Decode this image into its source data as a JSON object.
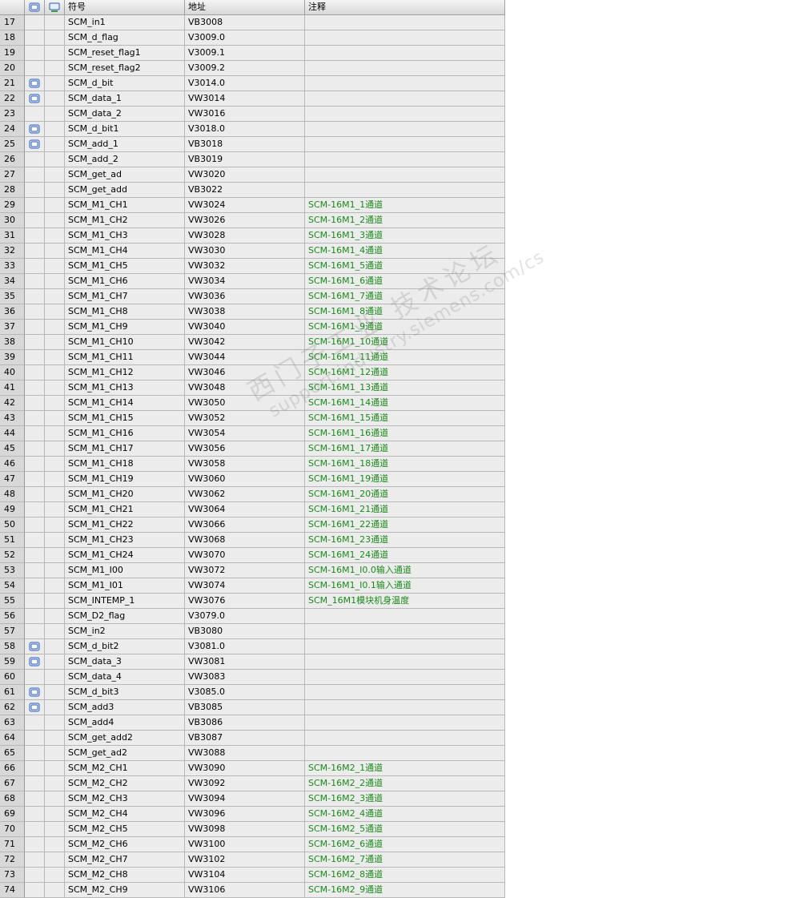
{
  "header": {
    "col_symbol": "符号",
    "col_address": "地址",
    "col_comment": "注释",
    "icon1": "symbol-overlap-icon",
    "icon2": "symbol-unused-icon"
  },
  "colors": {
    "comment_text": "#1a8a1a",
    "row_bg": "#ececec",
    "number_bg": "#d8d8d8"
  },
  "rows": [
    {
      "num": "17",
      "icon": false,
      "symbol": "SCM_in1",
      "address": "VB3008",
      "comment": ""
    },
    {
      "num": "18",
      "icon": false,
      "symbol": "SCM_d_flag",
      "address": "V3009.0",
      "comment": ""
    },
    {
      "num": "19",
      "icon": false,
      "symbol": "SCM_reset_flag1",
      "address": "V3009.1",
      "comment": ""
    },
    {
      "num": "20",
      "icon": false,
      "symbol": "SCM_reset_flag2",
      "address": "V3009.2",
      "comment": ""
    },
    {
      "num": "21",
      "icon": true,
      "symbol": "SCM_d_bit",
      "address": "V3014.0",
      "comment": ""
    },
    {
      "num": "22",
      "icon": true,
      "symbol": "SCM_data_1",
      "address": "VW3014",
      "comment": ""
    },
    {
      "num": "23",
      "icon": false,
      "symbol": "SCM_data_2",
      "address": "VW3016",
      "comment": ""
    },
    {
      "num": "24",
      "icon": true,
      "symbol": "SCM_d_bit1",
      "address": "V3018.0",
      "comment": ""
    },
    {
      "num": "25",
      "icon": true,
      "symbol": "SCM_add_1",
      "address": "VB3018",
      "comment": ""
    },
    {
      "num": "26",
      "icon": false,
      "symbol": "SCM_add_2",
      "address": "VB3019",
      "comment": ""
    },
    {
      "num": "27",
      "icon": false,
      "symbol": "SCM_get_ad",
      "address": "VW3020",
      "comment": ""
    },
    {
      "num": "28",
      "icon": false,
      "symbol": "SCM_get_add",
      "address": "VB3022",
      "comment": ""
    },
    {
      "num": "29",
      "icon": false,
      "symbol": "SCM_M1_CH1",
      "address": "VW3024",
      "comment": "SCM-16M1_1通道"
    },
    {
      "num": "30",
      "icon": false,
      "symbol": "SCM_M1_CH2",
      "address": "VW3026",
      "comment": "SCM-16M1_2通道"
    },
    {
      "num": "31",
      "icon": false,
      "symbol": "SCM_M1_CH3",
      "address": "VW3028",
      "comment": "SCM-16M1_3通道"
    },
    {
      "num": "32",
      "icon": false,
      "symbol": "SCM_M1_CH4",
      "address": "VW3030",
      "comment": "SCM-16M1_4通道"
    },
    {
      "num": "33",
      "icon": false,
      "symbol": "SCM_M1_CH5",
      "address": "VW3032",
      "comment": "SCM-16M1_5通道"
    },
    {
      "num": "34",
      "icon": false,
      "symbol": "SCM_M1_CH6",
      "address": "VW3034",
      "comment": "SCM-16M1_6通道"
    },
    {
      "num": "35",
      "icon": false,
      "symbol": "SCM_M1_CH7",
      "address": "VW3036",
      "comment": "SCM-16M1_7通道"
    },
    {
      "num": "36",
      "icon": false,
      "symbol": "SCM_M1_CH8",
      "address": "VW3038",
      "comment": "SCM-16M1_8通道"
    },
    {
      "num": "37",
      "icon": false,
      "symbol": "SCM_M1_CH9",
      "address": "VW3040",
      "comment": "SCM-16M1_9通道"
    },
    {
      "num": "38",
      "icon": false,
      "symbol": "SCM_M1_CH10",
      "address": "VW3042",
      "comment": "SCM-16M1_10通道"
    },
    {
      "num": "39",
      "icon": false,
      "symbol": "SCM_M1_CH11",
      "address": "VW3044",
      "comment": "SCM-16M1_11通道"
    },
    {
      "num": "40",
      "icon": false,
      "symbol": "SCM_M1_CH12",
      "address": "VW3046",
      "comment": "SCM-16M1_12通道"
    },
    {
      "num": "41",
      "icon": false,
      "symbol": "SCM_M1_CH13",
      "address": "VW3048",
      "comment": "SCM-16M1_13通道"
    },
    {
      "num": "42",
      "icon": false,
      "symbol": "SCM_M1_CH14",
      "address": "VW3050",
      "comment": "SCM-16M1_14通道"
    },
    {
      "num": "43",
      "icon": false,
      "symbol": "SCM_M1_CH15",
      "address": "VW3052",
      "comment": "SCM-16M1_15通道"
    },
    {
      "num": "44",
      "icon": false,
      "symbol": "SCM_M1_CH16",
      "address": "VW3054",
      "comment": "SCM-16M1_16通道"
    },
    {
      "num": "45",
      "icon": false,
      "symbol": "SCM_M1_CH17",
      "address": "VW3056",
      "comment": "SCM-16M1_17通道"
    },
    {
      "num": "46",
      "icon": false,
      "symbol": "SCM_M1_CH18",
      "address": "VW3058",
      "comment": "SCM-16M1_18通道"
    },
    {
      "num": "47",
      "icon": false,
      "symbol": "SCM_M1_CH19",
      "address": "VW3060",
      "comment": "SCM-16M1_19通道"
    },
    {
      "num": "48",
      "icon": false,
      "symbol": "SCM_M1_CH20",
      "address": "VW3062",
      "comment": "SCM-16M1_20通道"
    },
    {
      "num": "49",
      "icon": false,
      "symbol": "SCM_M1_CH21",
      "address": "VW3064",
      "comment": "SCM-16M1_21通道"
    },
    {
      "num": "50",
      "icon": false,
      "symbol": "SCM_M1_CH22",
      "address": "VW3066",
      "comment": "SCM-16M1_22通道"
    },
    {
      "num": "51",
      "icon": false,
      "symbol": "SCM_M1_CH23",
      "address": "VW3068",
      "comment": "SCM-16M1_23通道"
    },
    {
      "num": "52",
      "icon": false,
      "symbol": "SCM_M1_CH24",
      "address": "VW3070",
      "comment": "SCM-16M1_24通道"
    },
    {
      "num": "53",
      "icon": false,
      "symbol": "SCM_M1_I00",
      "address": "VW3072",
      "comment": "SCM-16M1_I0.0输入通道"
    },
    {
      "num": "54",
      "icon": false,
      "symbol": "SCM_M1_I01",
      "address": "VW3074",
      "comment": "SCM-16M1_I0.1输入通道"
    },
    {
      "num": "55",
      "icon": false,
      "symbol": "SCM_INTEMP_1",
      "address": "VW3076",
      "comment": "SCM_16M1模块机身温度"
    },
    {
      "num": "56",
      "icon": false,
      "symbol": "SCM_D2_flag",
      "address": "V3079.0",
      "comment": ""
    },
    {
      "num": "57",
      "icon": false,
      "symbol": "SCM_in2",
      "address": "VB3080",
      "comment": ""
    },
    {
      "num": "58",
      "icon": true,
      "symbol": "SCM_d_bit2",
      "address": "V3081.0",
      "comment": ""
    },
    {
      "num": "59",
      "icon": true,
      "symbol": "SCM_data_3",
      "address": "VW3081",
      "comment": ""
    },
    {
      "num": "60",
      "icon": false,
      "symbol": "SCM_data_4",
      "address": "VW3083",
      "comment": ""
    },
    {
      "num": "61",
      "icon": true,
      "symbol": "SCM_d_bit3",
      "address": "V3085.0",
      "comment": ""
    },
    {
      "num": "62",
      "icon": true,
      "symbol": "SCM_add3",
      "address": "VB3085",
      "comment": ""
    },
    {
      "num": "63",
      "icon": false,
      "symbol": "SCM_add4",
      "address": "VB3086",
      "comment": ""
    },
    {
      "num": "64",
      "icon": false,
      "symbol": "SCM_get_add2",
      "address": "VB3087",
      "comment": ""
    },
    {
      "num": "65",
      "icon": false,
      "symbol": "SCM_get_ad2",
      "address": "VW3088",
      "comment": ""
    },
    {
      "num": "66",
      "icon": false,
      "symbol": "SCM_M2_CH1",
      "address": "VW3090",
      "comment": "SCM-16M2_1通道"
    },
    {
      "num": "67",
      "icon": false,
      "symbol": "SCM_M2_CH2",
      "address": "VW3092",
      "comment": "SCM-16M2_2通道"
    },
    {
      "num": "68",
      "icon": false,
      "symbol": "SCM_M2_CH3",
      "address": "VW3094",
      "comment": "SCM-16M2_3通道"
    },
    {
      "num": "69",
      "icon": false,
      "symbol": "SCM_M2_CH4",
      "address": "VW3096",
      "comment": "SCM-16M2_4通道"
    },
    {
      "num": "70",
      "icon": false,
      "symbol": "SCM_M2_CH5",
      "address": "VW3098",
      "comment": "SCM-16M2_5通道"
    },
    {
      "num": "71",
      "icon": false,
      "symbol": "SCM_M2_CH6",
      "address": "VW3100",
      "comment": "SCM-16M2_6通道"
    },
    {
      "num": "72",
      "icon": false,
      "symbol": "SCM_M2_CH7",
      "address": "VW3102",
      "comment": "SCM-16M2_7通道"
    },
    {
      "num": "73",
      "icon": false,
      "symbol": "SCM_M2_CH8",
      "address": "VW3104",
      "comment": "SCM-16M2_8通道"
    },
    {
      "num": "74",
      "icon": false,
      "symbol": "SCM_M2_CH9",
      "address": "VW3106",
      "comment": "SCM-16M2_9通道"
    }
  ],
  "watermark": {
    "line1": "西门子工业 技术论坛",
    "line2": "support.industry.siemens.com/cs"
  }
}
